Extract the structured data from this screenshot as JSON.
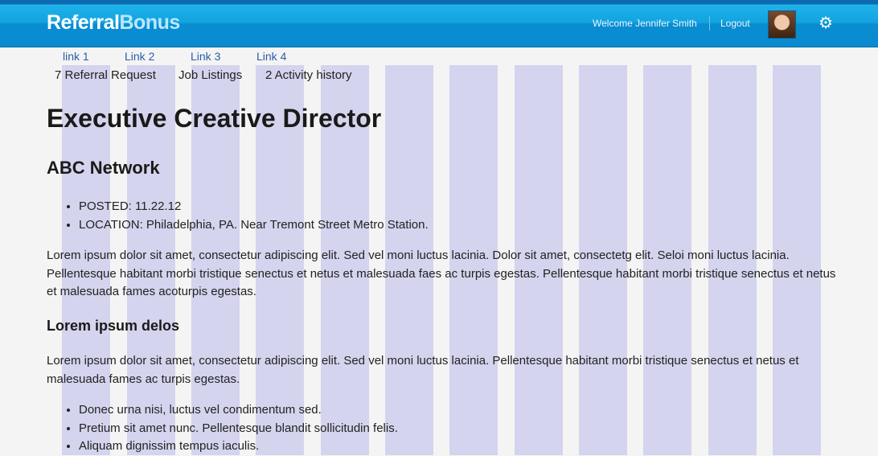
{
  "header": {
    "logo_part1": "Referral",
    "logo_part2": "Bonus",
    "welcome": "Welcome Jennifer Smith",
    "logout": "Logout",
    "settings_icon": "gear-icon"
  },
  "links": [
    "link 1",
    "Link 2",
    "Link 3",
    "Link 4"
  ],
  "nav": {
    "referral_request": "7 Referral Request",
    "job_listings": "Job Listings",
    "activity_history": "2 Activity history"
  },
  "job": {
    "title": "Executive Creative Director",
    "company": "ABC Network",
    "posted": "POSTED: 11.22.12",
    "location": "LOCATION: Philadelphia, PA. Near Tremont Street Metro Station.",
    "paragraph1": "Lorem ipsum dolor sit amet, consectetur adipiscing elit. Sed vel moni luctus lacinia. Dolor sit amet, consectetg elit. Seloi moni luctus lacinia. Pellentesque habitant morbi tristique senectus et netus et malesuada faes ac turpis egestas. Pellentesque habitant morbi tristique senectus et netus et malesuada fames acoturpis egestas.",
    "subheading": "Lorem ipsum delos",
    "paragraph2": "Lorem ipsum dolor sit amet, consectetur adipiscing elit. Sed vel moni luctus lacinia. Pellentesque habitant morbi tristique senectus et netus et malesuada fames ac turpis egestas.",
    "bullets": [
      "Donec urna nisi, luctus vel condimentum sed.",
      "Pretium sit amet nunc. Pellentesque blandit sollicitudin felis.",
      "Aliquam dignissim tempus iaculis."
    ]
  },
  "colors": {
    "header_blue": "#12a3e0",
    "grid_overlay": "#a0a0e6"
  }
}
